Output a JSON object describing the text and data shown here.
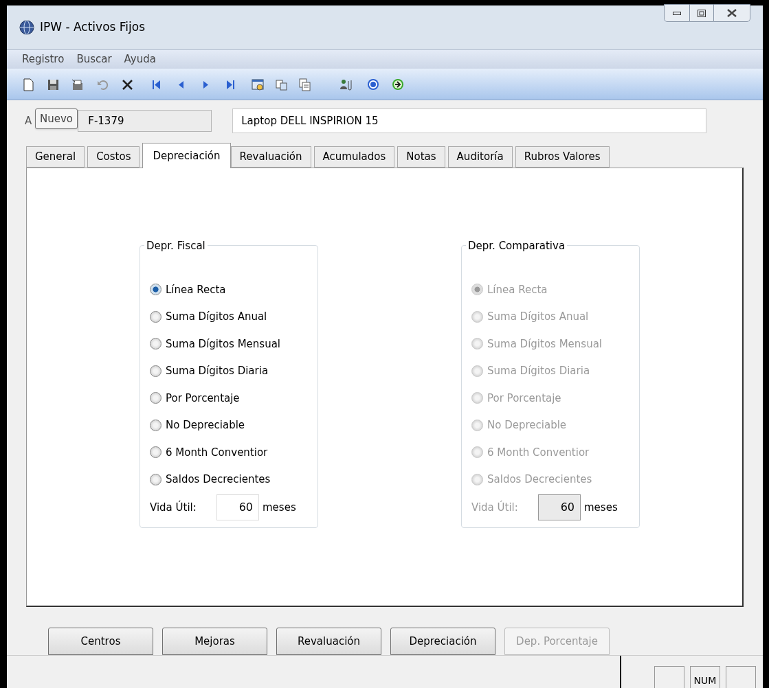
{
  "window": {
    "title": "IPW - Activos Fijos"
  },
  "menu": [
    "Registro",
    "Buscar",
    "Ayuda"
  ],
  "tooltip": "Nuevo",
  "header": {
    "label": "A",
    "code": "F-1379",
    "description": "Laptop DELL INSPIRION 15"
  },
  "tabs": [
    {
      "label": "General",
      "selected": false
    },
    {
      "label": "Costos",
      "selected": false
    },
    {
      "label": "Depreciación",
      "selected": true
    },
    {
      "label": "Revaluación",
      "selected": false
    },
    {
      "label": "Acumulados",
      "selected": false
    },
    {
      "label": "Notas",
      "selected": false
    },
    {
      "label": "Auditoría",
      "selected": false
    },
    {
      "label": "Rubros Valores",
      "selected": false
    }
  ],
  "groups": [
    {
      "title": "Depr. Fiscal",
      "disabled": false,
      "options": [
        {
          "label": "Línea Recta",
          "selected": true
        },
        {
          "label": "Suma Dígitos Anual",
          "selected": false
        },
        {
          "label": "Suma Dígitos Mensual",
          "selected": false
        },
        {
          "label": "Suma Dígitos Diaria",
          "selected": false
        },
        {
          "label": "Por Porcentaje",
          "selected": false
        },
        {
          "label": "No Depreciable",
          "selected": false
        },
        {
          "label": "6 Month Conventior",
          "selected": false
        },
        {
          "label": "Saldos Decrecientes",
          "selected": false
        }
      ],
      "life_label": "Vida Útil:",
      "life_value": "60",
      "life_unit": "meses"
    },
    {
      "title": "Depr. Comparativa",
      "disabled": true,
      "options": [
        {
          "label": "Línea Recta",
          "selected": true
        },
        {
          "label": "Suma Dígitos Anual",
          "selected": false
        },
        {
          "label": "Suma Dígitos Mensual",
          "selected": false
        },
        {
          "label": "Suma Dígitos Diaria",
          "selected": false
        },
        {
          "label": "Por Porcentaje",
          "selected": false
        },
        {
          "label": "No Depreciable",
          "selected": false
        },
        {
          "label": "6 Month Conventior",
          "selected": false
        },
        {
          "label": "Saldos Decrecientes",
          "selected": false
        }
      ],
      "life_label": "Vida Útil:",
      "life_value": "60",
      "life_unit": "meses"
    }
  ],
  "buttons": [
    {
      "label": "Centros",
      "disabled": false
    },
    {
      "label": "Mejoras",
      "disabled": false
    },
    {
      "label": "Revaluación",
      "disabled": false
    },
    {
      "label": "Depreciación",
      "disabled": false
    },
    {
      "label": "Dep. Porcentaje",
      "disabled": true
    }
  ],
  "status_bar": {
    "num": "NUM"
  }
}
